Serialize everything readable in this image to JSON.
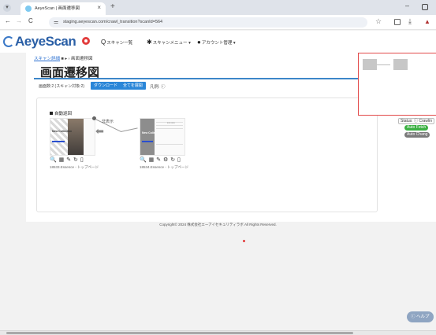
{
  "browser": {
    "tab_title": "AeyeScan | 画面遷移図",
    "tab_close": "×",
    "new_tab": "+",
    "min": "–",
    "url": "staging.aeyescan.com/crawl_transition?scanId=564",
    "nav": {
      "back": "←",
      "forward": "→",
      "reload": "C"
    },
    "bookmark_icon": "☆",
    "download_icon": "⤓"
  },
  "header": {
    "logo": "AeyeScan",
    "menu": [
      {
        "icon": "Q",
        "label": "スキャン一覧"
      },
      {
        "icon": "✱",
        "label": "スキャンメニュー ▾"
      },
      {
        "icon": "●",
        "label": "アカウント管理 ▾"
      }
    ]
  },
  "page": {
    "breadcrumb_link": "スキャン詳細",
    "breadcrumb_rest": " ■ ▸ › 画面遷移図",
    "title": "画面遷移図",
    "screen_count": "画面数:2 (スキャン対象:2)",
    "download_btn": "ダウンロード",
    "expand_btn": "全てを展開",
    "legend": "凡例: ⓘ"
  },
  "graph": {
    "group_label": "自動巡回",
    "edge_label": "非表示",
    "nodes": [
      {
        "id": "18533",
        "label": "18533.Essence - トップページ",
        "caption": "New Collection",
        "tools": "🔍 ▦ ✎   ↻ ▯"
      },
      {
        "id": "18534",
        "label": "18534.Essence - トップページ",
        "caption": "New Colle",
        "tools": "🔍 ▦ ✎ ⚙ ↻ ▯"
      }
    ]
  },
  "status_panel": {
    "status_label": "Status: ⓘ Crawlin",
    "pills": [
      {
        "label": "Auto Fetch",
        "color": "#3cb043"
      },
      {
        "label": "Auto Chang",
        "color": "#7a7a7a"
      }
    ]
  },
  "footer": {
    "copyright": "Copyright© 2024 株式会社エーアイセキュリティラボ All Rights Reserved."
  },
  "help_btn": "ⓘ ヘルプ"
}
